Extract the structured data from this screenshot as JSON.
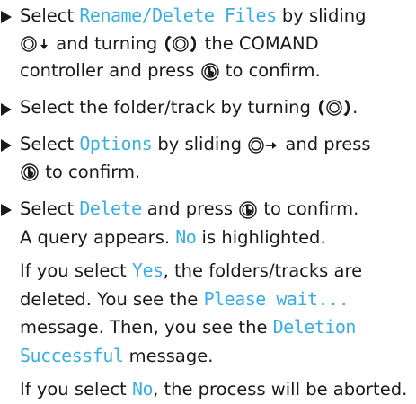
{
  "steps": [
    {
      "t1": "Select ",
      "hl1": "Rename/Delete Files",
      "t2": " by sliding",
      "t3": " and turning ",
      "t4": " the COMAND",
      "t5": "controller and press ",
      "t6": " to confirm."
    },
    {
      "t1": "Select the folder/track by turning ",
      "t2": "."
    },
    {
      "t1": "Select ",
      "hl1": "Options",
      "t2": " by sliding ",
      "t3": " and press",
      "t4": " to confirm."
    },
    {
      "t1": "Select ",
      "hl1": "Delete",
      "t2": " and press ",
      "t3": " to confirm.",
      "t4": "A query appears. ",
      "hl2": "No",
      "t5": " is highlighted."
    }
  ],
  "para_yes": {
    "t1": "If you select ",
    "hl1": "Yes",
    "t2": ", the folders/tracks are deleted. You see the ",
    "hl2": "Please wait...",
    "t3": " message. Then, you see the ",
    "hl3": "Deletion Successful",
    "t4": " message."
  },
  "para_no": {
    "t1": "If you select ",
    "hl1": "No",
    "t2": ", the process will be aborted."
  },
  "icons": {
    "slide_down": "controller-slide-down-icon",
    "slide_right": "controller-slide-right-icon",
    "turn": "controller-turn-icon",
    "press": "controller-press-icon"
  },
  "colors": {
    "highlight": "#3aaee0",
    "text": "#1a1a1a"
  }
}
